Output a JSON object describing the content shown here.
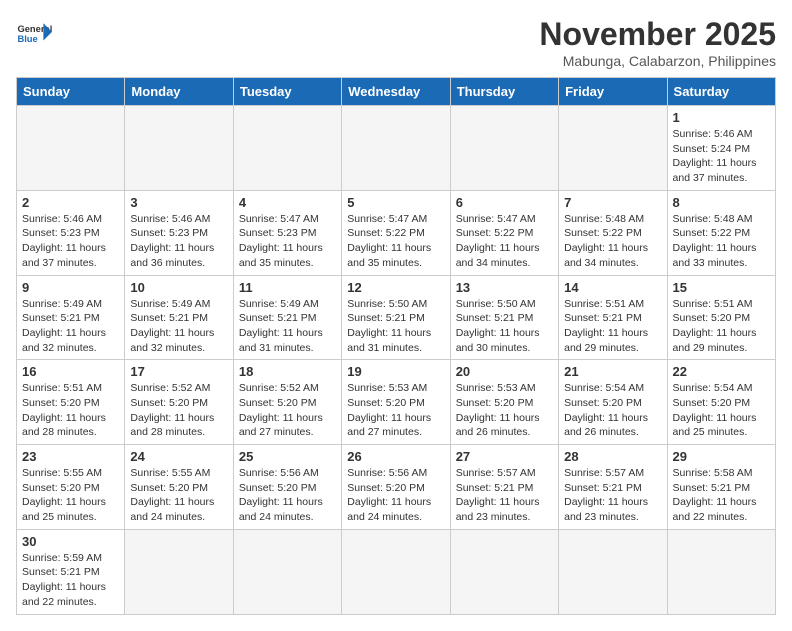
{
  "header": {
    "logo_general": "General",
    "logo_blue": "Blue",
    "month_title": "November 2025",
    "location": "Mabunga, Calabarzon, Philippines"
  },
  "days_of_week": [
    "Sunday",
    "Monday",
    "Tuesday",
    "Wednesday",
    "Thursday",
    "Friday",
    "Saturday"
  ],
  "weeks": [
    [
      {
        "day": "",
        "info": ""
      },
      {
        "day": "",
        "info": ""
      },
      {
        "day": "",
        "info": ""
      },
      {
        "day": "",
        "info": ""
      },
      {
        "day": "",
        "info": ""
      },
      {
        "day": "",
        "info": ""
      },
      {
        "day": "1",
        "info": "Sunrise: 5:46 AM\nSunset: 5:24 PM\nDaylight: 11 hours and 37 minutes."
      }
    ],
    [
      {
        "day": "2",
        "info": "Sunrise: 5:46 AM\nSunset: 5:23 PM\nDaylight: 11 hours and 37 minutes."
      },
      {
        "day": "3",
        "info": "Sunrise: 5:46 AM\nSunset: 5:23 PM\nDaylight: 11 hours and 36 minutes."
      },
      {
        "day": "4",
        "info": "Sunrise: 5:47 AM\nSunset: 5:23 PM\nDaylight: 11 hours and 35 minutes."
      },
      {
        "day": "5",
        "info": "Sunrise: 5:47 AM\nSunset: 5:22 PM\nDaylight: 11 hours and 35 minutes."
      },
      {
        "day": "6",
        "info": "Sunrise: 5:47 AM\nSunset: 5:22 PM\nDaylight: 11 hours and 34 minutes."
      },
      {
        "day": "7",
        "info": "Sunrise: 5:48 AM\nSunset: 5:22 PM\nDaylight: 11 hours and 34 minutes."
      },
      {
        "day": "8",
        "info": "Sunrise: 5:48 AM\nSunset: 5:22 PM\nDaylight: 11 hours and 33 minutes."
      }
    ],
    [
      {
        "day": "9",
        "info": "Sunrise: 5:49 AM\nSunset: 5:21 PM\nDaylight: 11 hours and 32 minutes."
      },
      {
        "day": "10",
        "info": "Sunrise: 5:49 AM\nSunset: 5:21 PM\nDaylight: 11 hours and 32 minutes."
      },
      {
        "day": "11",
        "info": "Sunrise: 5:49 AM\nSunset: 5:21 PM\nDaylight: 11 hours and 31 minutes."
      },
      {
        "day": "12",
        "info": "Sunrise: 5:50 AM\nSunset: 5:21 PM\nDaylight: 11 hours and 31 minutes."
      },
      {
        "day": "13",
        "info": "Sunrise: 5:50 AM\nSunset: 5:21 PM\nDaylight: 11 hours and 30 minutes."
      },
      {
        "day": "14",
        "info": "Sunrise: 5:51 AM\nSunset: 5:21 PM\nDaylight: 11 hours and 29 minutes."
      },
      {
        "day": "15",
        "info": "Sunrise: 5:51 AM\nSunset: 5:20 PM\nDaylight: 11 hours and 29 minutes."
      }
    ],
    [
      {
        "day": "16",
        "info": "Sunrise: 5:51 AM\nSunset: 5:20 PM\nDaylight: 11 hours and 28 minutes."
      },
      {
        "day": "17",
        "info": "Sunrise: 5:52 AM\nSunset: 5:20 PM\nDaylight: 11 hours and 28 minutes."
      },
      {
        "day": "18",
        "info": "Sunrise: 5:52 AM\nSunset: 5:20 PM\nDaylight: 11 hours and 27 minutes."
      },
      {
        "day": "19",
        "info": "Sunrise: 5:53 AM\nSunset: 5:20 PM\nDaylight: 11 hours and 27 minutes."
      },
      {
        "day": "20",
        "info": "Sunrise: 5:53 AM\nSunset: 5:20 PM\nDaylight: 11 hours and 26 minutes."
      },
      {
        "day": "21",
        "info": "Sunrise: 5:54 AM\nSunset: 5:20 PM\nDaylight: 11 hours and 26 minutes."
      },
      {
        "day": "22",
        "info": "Sunrise: 5:54 AM\nSunset: 5:20 PM\nDaylight: 11 hours and 25 minutes."
      }
    ],
    [
      {
        "day": "23",
        "info": "Sunrise: 5:55 AM\nSunset: 5:20 PM\nDaylight: 11 hours and 25 minutes."
      },
      {
        "day": "24",
        "info": "Sunrise: 5:55 AM\nSunset: 5:20 PM\nDaylight: 11 hours and 24 minutes."
      },
      {
        "day": "25",
        "info": "Sunrise: 5:56 AM\nSunset: 5:20 PM\nDaylight: 11 hours and 24 minutes."
      },
      {
        "day": "26",
        "info": "Sunrise: 5:56 AM\nSunset: 5:20 PM\nDaylight: 11 hours and 24 minutes."
      },
      {
        "day": "27",
        "info": "Sunrise: 5:57 AM\nSunset: 5:21 PM\nDaylight: 11 hours and 23 minutes."
      },
      {
        "day": "28",
        "info": "Sunrise: 5:57 AM\nSunset: 5:21 PM\nDaylight: 11 hours and 23 minutes."
      },
      {
        "day": "29",
        "info": "Sunrise: 5:58 AM\nSunset: 5:21 PM\nDaylight: 11 hours and 22 minutes."
      }
    ],
    [
      {
        "day": "30",
        "info": "Sunrise: 5:59 AM\nSunset: 5:21 PM\nDaylight: 11 hours and 22 minutes."
      },
      {
        "day": "",
        "info": ""
      },
      {
        "day": "",
        "info": ""
      },
      {
        "day": "",
        "info": ""
      },
      {
        "day": "",
        "info": ""
      },
      {
        "day": "",
        "info": ""
      },
      {
        "day": "",
        "info": ""
      }
    ]
  ]
}
